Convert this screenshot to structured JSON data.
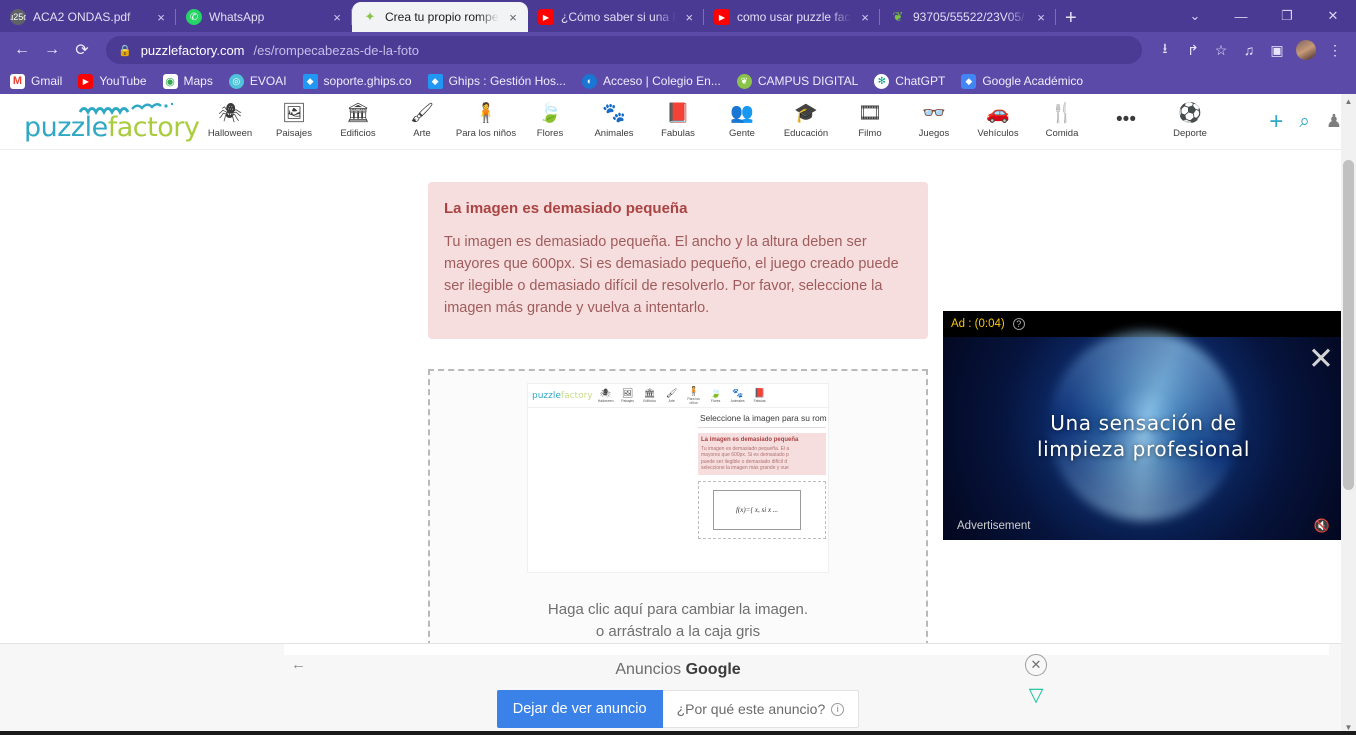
{
  "browser": {
    "tabs": [
      {
        "title": "ACA2 ONDAS.pdf",
        "favicon": "pdf-icon",
        "active": false,
        "close": "×"
      },
      {
        "title": "WhatsApp",
        "favicon": "whatsapp-icon",
        "active": false,
        "close": "×"
      },
      {
        "title": "Crea tu propio rompe",
        "favicon": "puzzlefactory-icon",
        "active": true,
        "close": "×"
      },
      {
        "title": "¿Cómo saber si una F",
        "favicon": "youtube-icon",
        "active": false,
        "close": "×"
      },
      {
        "title": "como usar puzzle fac",
        "favicon": "youtube-icon",
        "active": false,
        "close": "×"
      },
      {
        "title": "93705/55522/23V05/",
        "favicon": "leaf-icon",
        "active": false,
        "close": "×"
      }
    ],
    "new_tab": "+",
    "window": {
      "minimize": "—",
      "maximize": "❐",
      "close": "✕",
      "tab_search": "⌄"
    },
    "nav": {
      "back": "←",
      "forward": "→",
      "reload": "⟳"
    },
    "omnibox": {
      "lock": "🔒",
      "host": "puzzlefactory.com",
      "path": "/es/rompecabezas-de-la-foto"
    },
    "toolbar_icons": [
      {
        "name": "install-icon",
        "glyph": "⭳"
      },
      {
        "name": "share-icon",
        "glyph": "↱"
      },
      {
        "name": "bookmark-star-icon",
        "glyph": "☆"
      },
      {
        "name": "media-list-icon",
        "glyph": "♫"
      },
      {
        "name": "sidepanel-icon",
        "glyph": "▣"
      },
      {
        "name": "chrome-menu-icon",
        "glyph": "⋮"
      }
    ],
    "bookmarks": [
      {
        "label": "Gmail",
        "icon": "gmail-icon",
        "glyph": "M"
      },
      {
        "label": "YouTube",
        "icon": "youtube-icon",
        "glyph": "▶"
      },
      {
        "label": "Maps",
        "icon": "maps-icon",
        "glyph": "◉"
      },
      {
        "label": "EVOAI",
        "icon": "evoai-icon",
        "glyph": "◎"
      },
      {
        "label": "soporte.ghips.co",
        "icon": "ghips-icon",
        "glyph": "◆"
      },
      {
        "label": "Ghips : Gestión Hos...",
        "icon": "ghips-icon",
        "glyph": "◆"
      },
      {
        "label": "Acceso | Colegio En...",
        "icon": "globe-icon",
        "glyph": "◐"
      },
      {
        "label": "CAMPUS DIGITAL",
        "icon": "leaf-icon",
        "glyph": "❦"
      },
      {
        "label": "ChatGPT",
        "icon": "chatgpt-icon",
        "glyph": "✻"
      },
      {
        "label": "Google Académico",
        "icon": "scholar-icon",
        "glyph": "◆"
      }
    ]
  },
  "site": {
    "logo": {
      "part1": "puzzle",
      "part2": "factory"
    },
    "nav_items": [
      {
        "label": "Halloween",
        "icon": "spider-icon",
        "glyph": "🕷"
      },
      {
        "label": "Paisajes",
        "icon": "landscape-icon",
        "glyph": "🖼"
      },
      {
        "label": "Edificios",
        "icon": "building-icon",
        "glyph": "🏛"
      },
      {
        "label": "Arte",
        "icon": "paintbrush-icon",
        "glyph": "🖌"
      },
      {
        "label": "Para los niños",
        "icon": "child-icon",
        "glyph": "🧍"
      },
      {
        "label": "Flores",
        "icon": "leaf-icon",
        "glyph": "🍃"
      },
      {
        "label": "Animales",
        "icon": "paw-icon",
        "glyph": "🐾"
      },
      {
        "label": "Fabulas",
        "icon": "book-icon",
        "glyph": "📕"
      },
      {
        "label": "Gente",
        "icon": "people-icon",
        "glyph": "👥"
      },
      {
        "label": "Educación",
        "icon": "graduate-icon",
        "glyph": "🎓"
      },
      {
        "label": "Filmo",
        "icon": "film-icon",
        "glyph": "🎞"
      },
      {
        "label": "Juegos",
        "icon": "games-icon",
        "glyph": "⚽"
      },
      {
        "label": "Vehículos",
        "icon": "car-icon",
        "glyph": "🚗"
      },
      {
        "label": "Comida",
        "icon": "food-icon",
        "glyph": "🍴"
      },
      {
        "label": "",
        "icon": "more-dots-icon",
        "glyph": "•••"
      },
      {
        "label": "Deporte",
        "icon": "sport-ball-icon",
        "glyph": "⚽"
      }
    ],
    "actions": {
      "add": "+",
      "search": "⌕",
      "user": "♟"
    },
    "alert": {
      "title": "La imagen es demasiado pequeña",
      "body": "Tu imagen es demasiado pequeña. El ancho y la altura deben ser mayores que 600px. Si es demasiado pequeño, el juego creado puede ser ilegible o demasiado difícil de resolverlo. Por favor, seleccione la imagen más grande y vuelva a intentarlo."
    },
    "dropzone": {
      "line1": "Haga clic aquí para cambiar la imagen.",
      "line2": "o arrástralo a la caja gris",
      "thumbnail": {
        "logo1": "puzzle",
        "logo2": "factory",
        "heading": "Seleccione la imagen para su rom",
        "alert_title": "La imagen es demasiado pequeña",
        "alert_l1": "Tu imagen es demasiado pequeña. El a",
        "alert_l2": "mayores que 600px. Si es demasiado p",
        "alert_l3": "puede ser ilegible o demasiado difícil d",
        "alert_l4": "seleccione la imagen más grande y vue",
        "formula": "f(x)={ x, si x ..."
      }
    }
  },
  "video_ad": {
    "label": "Ad : (0:04)",
    "help": "?",
    "close": "✕",
    "headline_line1": "Una sensación de",
    "headline_line2": "limpieza profesional",
    "footer": "Advertisement",
    "mute": "🔇"
  },
  "bottom_ad": {
    "back_arrow": "←",
    "title_prefix": "Anuncios ",
    "title_brand": "Google",
    "stop_button": "Dejar de ver anuncio",
    "why_button": "¿Por qué este anuncio?",
    "info_glyph": "i",
    "close_glyph": "✕",
    "freestar_glyph": "▽"
  },
  "scrollbar": {
    "up": "▲",
    "down": "▼"
  },
  "colors": {
    "chrome_purple": "#5b4aa8",
    "chrome_purple_dark": "#4a3a93",
    "alert_bg": "#f6dede",
    "alert_title": "#a94442",
    "logo_blue": "#2fa8c4",
    "logo_green": "#a8cc3d",
    "ad_blue": "#3b82e8",
    "ad_yellow": "#f5c518"
  }
}
